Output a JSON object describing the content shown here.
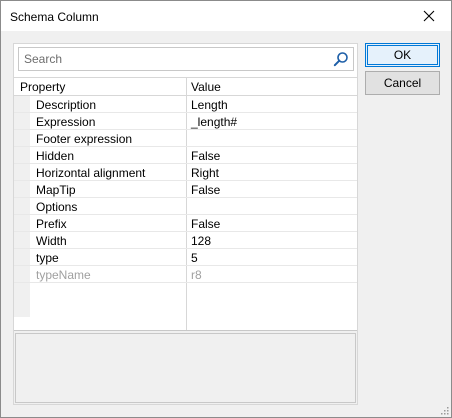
{
  "window": {
    "title": "Schema Column"
  },
  "search": {
    "placeholder": "Search",
    "value": ""
  },
  "grid": {
    "headers": {
      "property": "Property",
      "value": "Value"
    },
    "rows": [
      {
        "name": "Description",
        "value": "Length"
      },
      {
        "name": "Expression",
        "value": "_length#"
      },
      {
        "name": "Footer expression",
        "value": ""
      },
      {
        "name": "Hidden",
        "value": "False"
      },
      {
        "name": "Horizontal alignment",
        "value": "Right"
      },
      {
        "name": "MapTip",
        "value": "False"
      },
      {
        "name": "Options",
        "value": ""
      },
      {
        "name": "Prefix",
        "value": "False"
      },
      {
        "name": "Width",
        "value": "128"
      },
      {
        "name": "type",
        "value": "5"
      },
      {
        "name": "typeName",
        "value": "r8",
        "disabled": true
      }
    ]
  },
  "buttons": {
    "ok": "OK",
    "cancel": "Cancel"
  },
  "colors": {
    "accent": "#0078d7",
    "search_icon": "#1e5fa8",
    "disabled_text": "#a0a0a0"
  },
  "icons": {
    "close": "close-icon",
    "search": "search-icon",
    "resize": "resize-grip-icon"
  }
}
